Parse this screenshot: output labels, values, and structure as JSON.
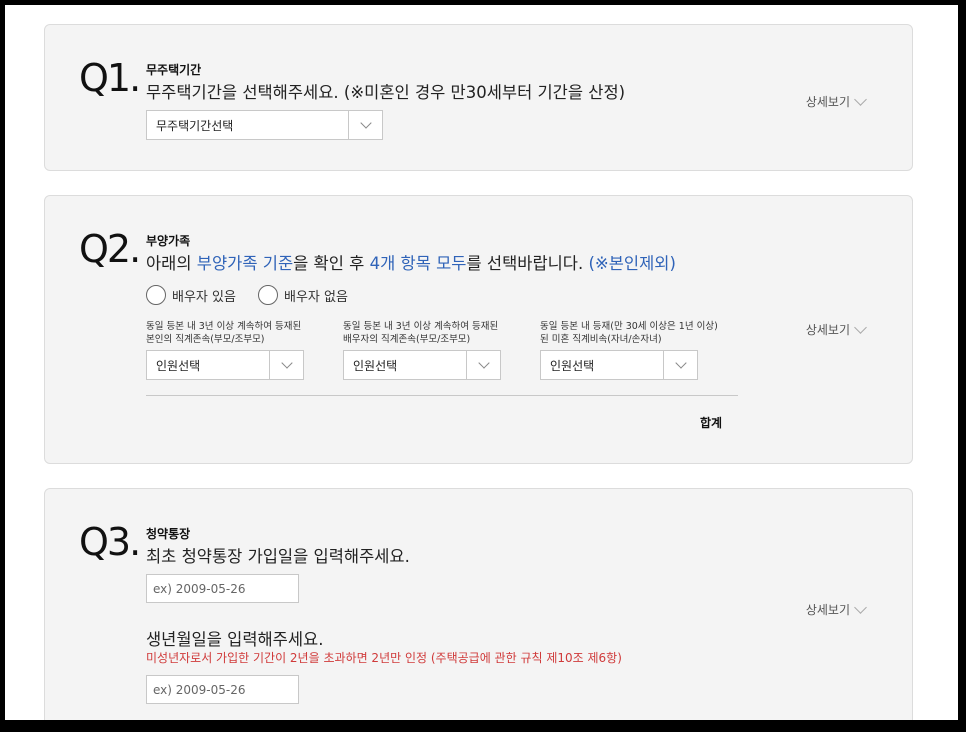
{
  "detail_label": "상세보기",
  "q1": {
    "num": "Q1",
    "category": "무주택기간",
    "question": "무주택기간을 선택해주세요. (※미혼인 경우 만30세부터 기간을 산정)",
    "select_value": "무주택기간선택"
  },
  "q2": {
    "num": "Q2",
    "category": "부양가족",
    "question_pre": "아래의 ",
    "question_link1": "부양가족 기준",
    "question_mid": "을 확인 후 ",
    "question_link2": "4개 항목 모두",
    "question_post": "를 선택바랍니다. ",
    "question_note": "(※본인제외)",
    "radio1": "배우자 있음",
    "radio2": "배우자 없음",
    "groups": [
      {
        "label1": "동일 등본 내 3년 이상 계속하여 등재된",
        "label2": "본인의 직계존속(부모/조부모)",
        "select_value": "인원선택"
      },
      {
        "label1": "동일 등본 내 3년 이상 계속하여 등재된",
        "label2": "배우자의 직계존속(부모/조부모)",
        "select_value": "인원선택"
      },
      {
        "label1": "동일 등본 내 등재(만 30세 이상은 1년 이상)",
        "label2": "된 미혼 직계비속(자녀/손자녀)",
        "select_value": "인원선택"
      }
    ],
    "total_label": "합계"
  },
  "q3": {
    "num": "Q3",
    "category": "청약통장",
    "question": "최초 청약통장 가입일을 입력해주세요.",
    "input1_placeholder": "ex) 2009-05-26",
    "question2": "생년월일을 입력해주세요.",
    "note": "미성년자로서 가입한 기간이 2년을 초과하면 2년만 인정 (주택공급에 관한 규칙 제10조 제6항)",
    "input2_placeholder": "ex) 2009-05-26"
  }
}
